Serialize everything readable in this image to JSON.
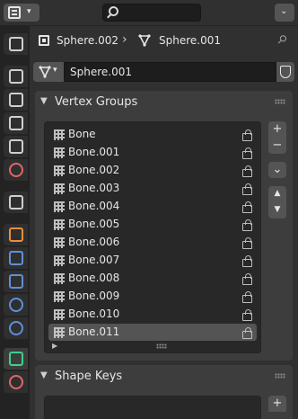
{
  "header": {
    "search": {
      "value": "",
      "placeholder": ""
    }
  },
  "tabs": [
    {
      "name": "tool",
      "icon": "tool-icon",
      "color": "#d0d0d0"
    },
    {
      "name": "render",
      "icon": "render-icon",
      "color": "#cfcfcf"
    },
    {
      "name": "output",
      "icon": "output-icon",
      "color": "#cfcfcf"
    },
    {
      "name": "view-layer",
      "icon": "view-layer-icon",
      "color": "#cfcfcf"
    },
    {
      "name": "scene",
      "icon": "scene-icon",
      "color": "#cfcfcf"
    },
    {
      "name": "world",
      "icon": "world-icon",
      "color": "#e06666"
    },
    {
      "name": "collection",
      "icon": "collection-icon",
      "color": "#cfcfcf"
    },
    {
      "name": "object",
      "icon": "object-icon",
      "color": "#e6903c"
    },
    {
      "name": "modifiers",
      "icon": "wrench-icon",
      "color": "#5f8fd6"
    },
    {
      "name": "particles",
      "icon": "particles-icon",
      "color": "#5f8fd6"
    },
    {
      "name": "physics",
      "icon": "physics-icon",
      "color": "#5f8fd6"
    },
    {
      "name": "constraints",
      "icon": "constraints-icon",
      "color": "#5f8fd6"
    },
    {
      "name": "data",
      "icon": "mesh-data-icon",
      "color": "#3fd08a",
      "active": true
    },
    {
      "name": "material",
      "icon": "material-icon",
      "color": "#e06666"
    }
  ],
  "breadcrumb": {
    "object": "Sphere.002",
    "mesh": "Sphere.001"
  },
  "datablock": {
    "name": "Sphere.001"
  },
  "vertex_groups": {
    "title": "Vertex Groups",
    "items": [
      {
        "label": "Bone"
      },
      {
        "label": "Bone.001"
      },
      {
        "label": "Bone.002"
      },
      {
        "label": "Bone.003"
      },
      {
        "label": "Bone.004"
      },
      {
        "label": "Bone.005"
      },
      {
        "label": "Bone.006"
      },
      {
        "label": "Bone.007"
      },
      {
        "label": "Bone.008"
      },
      {
        "label": "Bone.009"
      },
      {
        "label": "Bone.010"
      },
      {
        "label": "Bone.011",
        "selected": true
      }
    ],
    "buttons": {
      "add": "+",
      "remove": "−",
      "specials": "⌄",
      "up": "▲",
      "down": "▼"
    }
  },
  "shape_keys": {
    "title": "Shape Keys",
    "buttons": {
      "add": "+"
    }
  }
}
